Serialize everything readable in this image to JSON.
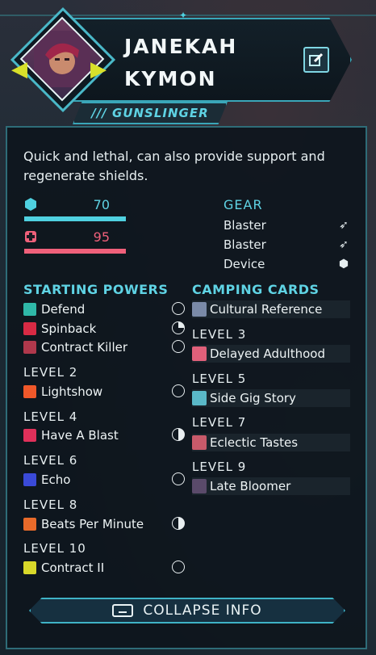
{
  "character": {
    "first_name": "JANEKAH",
    "last_name": "KYMON",
    "class": "/// GUNSLINGER",
    "description": "Quick and lethal, can also provide support and regenerate shields."
  },
  "stats": {
    "shield": {
      "icon": "shield-icon",
      "value": "70",
      "color": "#4fd1e0"
    },
    "health": {
      "icon": "health-cross-icon",
      "value": "95",
      "color": "#f0607a"
    }
  },
  "gear": {
    "title": "GEAR",
    "items": [
      {
        "label": "Blaster",
        "icon": "blaster-icon"
      },
      {
        "label": "Blaster",
        "icon": "blaster-icon"
      },
      {
        "label": "Device",
        "icon": "device-icon"
      }
    ]
  },
  "powers": {
    "title": "STARTING POWERS",
    "starting": [
      {
        "name": "Defend",
        "icon": "defend-icon",
        "cost": "full-clock"
      },
      {
        "name": "Spinback",
        "icon": "spinback-icon",
        "cost": "quarter-clock"
      },
      {
        "name": "Contract Killer",
        "icon": "contract-killer-icon",
        "cost": "full-clock"
      }
    ],
    "levels": [
      {
        "level": "LEVEL 2",
        "name": "Lightshow",
        "icon": "lightshow-icon",
        "cost": "full-clock"
      },
      {
        "level": "LEVEL 4",
        "name": "Have A Blast",
        "icon": "have-a-blast-icon",
        "cost": "half-clock"
      },
      {
        "level": "LEVEL 6",
        "name": "Echo",
        "icon": "echo-icon",
        "cost": "full-clock"
      },
      {
        "level": "LEVEL 8",
        "name": "Beats Per Minute",
        "icon": "beats-per-minute-icon",
        "cost": "half-clock"
      },
      {
        "level": "LEVEL 10",
        "name": "Contract II",
        "icon": "contract-ii-icon",
        "cost": "full-clock"
      }
    ]
  },
  "camping": {
    "title": "CAMPING CARDS",
    "starting": {
      "name": "Cultural Reference",
      "icon": "cultural-reference-card-icon"
    },
    "levels": [
      {
        "level": "LEVEL 3",
        "name": "Delayed Adulthood",
        "icon": "delayed-adulthood-card-icon"
      },
      {
        "level": "LEVEL 5",
        "name": "Side Gig Story",
        "icon": "side-gig-story-card-icon"
      },
      {
        "level": "LEVEL 7",
        "name": "Eclectic Tastes",
        "icon": "eclectic-tastes-card-icon"
      },
      {
        "level": "LEVEL 9",
        "name": "Late Bloomer",
        "icon": "late-bloomer-card-icon"
      }
    ]
  },
  "footer": {
    "collapse_label": "COLLAPSE INFO"
  }
}
